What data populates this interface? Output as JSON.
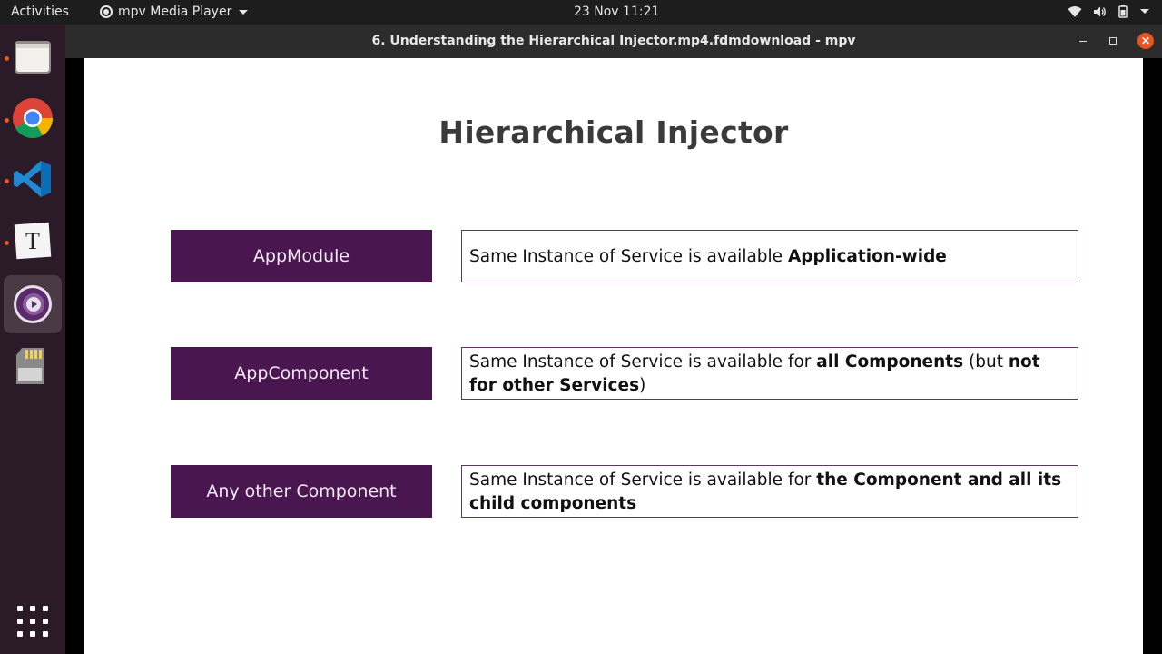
{
  "topbar": {
    "activities": "Activities",
    "app_name": "mpv Media Player",
    "clock": "23 Nov  11:21"
  },
  "dock": {
    "items": [
      "files",
      "chrome",
      "vscode",
      "typora",
      "mpv",
      "sd-card"
    ]
  },
  "window": {
    "title": "6. Understanding the Hierarchical Injector.mp4.fdmdownload - mpv",
    "close_glyph": "✕"
  },
  "slide": {
    "title": "Hierarchical Injector",
    "rows": [
      {
        "label": "AppModule",
        "desc_parts": [
          "Same Instance of Service is available ",
          "Application-wide"
        ]
      },
      {
        "label": "AppComponent",
        "desc_parts": [
          "Same Instance of Service is available for ",
          "all Components",
          " (but ",
          "not for other Services",
          ")"
        ]
      },
      {
        "label": "Any other Component",
        "desc_parts": [
          "Same Instance of Service is available for ",
          "the Component and all its child components"
        ]
      }
    ]
  },
  "colors": {
    "accent": "#e95420",
    "label_bg": "#4a1650",
    "dock_bg": "#2b1a27"
  }
}
